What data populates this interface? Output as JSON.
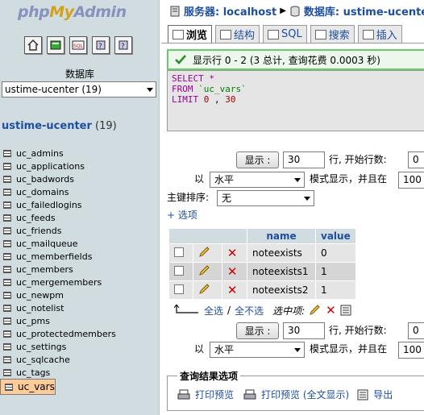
{
  "logo": {
    "part1": "php",
    "part2": "My",
    "part3": "Admin"
  },
  "left": {
    "quick_icons": [
      "home-icon",
      "query-window-icon",
      "sql-icon",
      "docs-icon",
      "help-icon"
    ],
    "db_label": "数据库",
    "db_select": "ustime-ucenter (19)",
    "db_title": "ustime-ucenter",
    "db_count": "(19)",
    "tables": [
      "uc_admins",
      "uc_applications",
      "uc_badwords",
      "uc_domains",
      "uc_failedlogins",
      "uc_feeds",
      "uc_friends",
      "uc_mailqueue",
      "uc_memberfields",
      "uc_members",
      "uc_mergemembers",
      "uc_newpm",
      "uc_notelist",
      "uc_pms",
      "uc_protectedmembers",
      "uc_settings",
      "uc_sqlcache",
      "uc_tags",
      "uc_vars"
    ],
    "selected_table": "uc_vars"
  },
  "breadcrumb": {
    "server_label": "服务器: localhost",
    "db_label": "数据库: ustime-ucenter"
  },
  "tabs": {
    "browse": "浏览",
    "structure": "结构",
    "sql": "SQL",
    "search": "搜索",
    "insert": "插入"
  },
  "success": {
    "text": "显示行  0 - 2 (3 总计, 查询花费  0.0003 秒)"
  },
  "sql": {
    "line1_kw": "SELECT",
    "line1_rest": " *",
    "line2_kw": "FROM",
    "line2_rest": " `uc_vars`",
    "line3_kw": "LIMIT",
    "line3_a": " 0",
    "line3_sep": " , ",
    "line3_b": "30"
  },
  "nav1": {
    "show_button": "显示 :",
    "rows_value": "30",
    "start_label": "行, 开始行数:",
    "start_value": "0",
    "mode_prefix": "以",
    "mode_value": "水平",
    "mode_label": "模式显示，并且在",
    "repeat_value": "100"
  },
  "sort": {
    "label": "主键排序:",
    "value": "无"
  },
  "options_link": "+ 选项",
  "table": {
    "columns": [
      "name",
      "value"
    ],
    "rows": [
      {
        "name": "noteexists",
        "value": "0"
      },
      {
        "name": "noteexists1",
        "value": "1"
      },
      {
        "name": "noteexists2",
        "value": "1"
      }
    ]
  },
  "bulk": {
    "check_all": "全选",
    "separator": " / ",
    "uncheck_all": "全不选",
    "with_selected": "选中项:"
  },
  "nav2": {
    "show_button": "显示 :",
    "rows_value": "30",
    "start_label": "行, 开始行数:",
    "start_value": "0",
    "mode_prefix": "以",
    "mode_value": "水平",
    "mode_label": "模式显示，并且在",
    "repeat_value": "100"
  },
  "results": {
    "legend": "查询结果选项",
    "print_view": "打印预览",
    "print_full": "打印预览 (全文显示)",
    "export": "导出"
  }
}
